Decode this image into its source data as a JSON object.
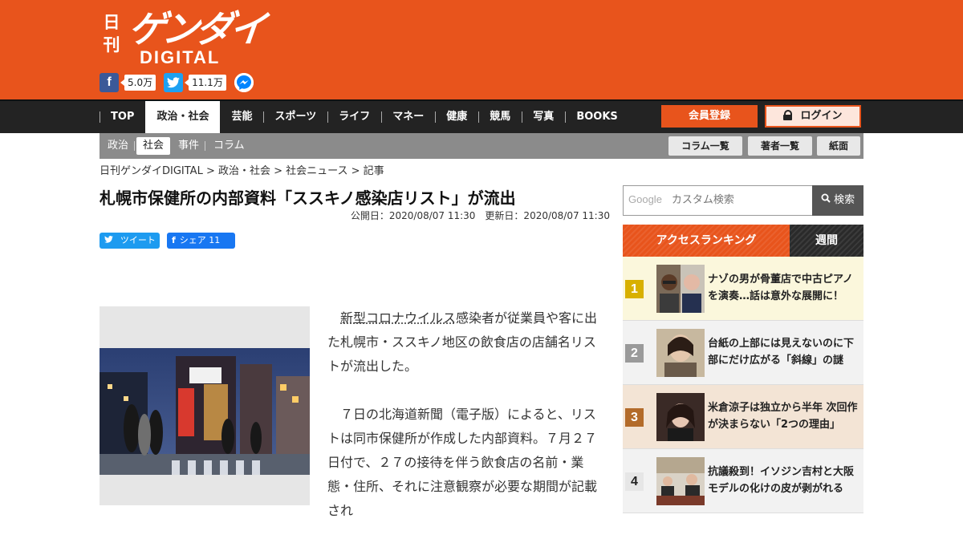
{
  "brand": {
    "logo_nikkan": "日刊",
    "logo_gendai": "ゲンダイ",
    "logo_digital": "DIGITAL"
  },
  "social": {
    "facebook_count": "5.0万",
    "twitter_count": "11.1万"
  },
  "nav": {
    "items": [
      "TOP",
      "政治・社会",
      "芸能",
      "スポーツ",
      "ライフ",
      "マネー",
      "健康",
      "競馬",
      "写真",
      "BOOKS"
    ],
    "member_label": "会員登録",
    "login_label": "ログイン"
  },
  "subnav": {
    "items": [
      "政治",
      "社会",
      "事件",
      "コラム"
    ],
    "buttons": [
      "コラム一覧",
      "著者一覧",
      "紙面"
    ]
  },
  "breadcrumb": "日刊ゲンダイDIGITAL > 政治・社会 > 社会ニュース > 記事",
  "article": {
    "title": "札幌市保健所の内部資料「ススキノ感染店リスト」が流出",
    "dates": "公開日：2020/08/07 11:30　更新日：2020/08/07 11:30",
    "tweet_label": "ツイート",
    "share_label": "シェア 11",
    "body_link": "新型コロナウイルス",
    "body_p1_rest": "感染者が従業員や客に出た札幌市・ススキノ地区の飲食店の店舗名リストが流出した。",
    "body_p2": "７日の北海道新聞（電子版）によると、リストは同市保健所が作成した内部資料。７月２７日付で、２７の接待を伴う飲食店の名前・業態・住所、それに注意観察が必要な期間が記載され"
  },
  "sidebar": {
    "search_google": "Google",
    "search_placeholder": "カスタム検索",
    "search_button": "検索",
    "tab_access": "アクセスランキング",
    "tab_weekly": "週間",
    "ranking": [
      {
        "num": "1",
        "text": "ナゾの男が骨董店で中古ピアノを演奏…話は意外な展開に！"
      },
      {
        "num": "2",
        "text": "台紙の上部には見えないのに下部にだけ広がる「斜線」の謎"
      },
      {
        "num": "3",
        "text": "米倉涼子は独立から半年 次回作が決まらない「2つの理由」"
      },
      {
        "num": "4",
        "text": "抗議殺到！イソジン吉村と大阪モデルの化けの皮が剥がれる"
      }
    ]
  },
  "colors": {
    "brand_orange": "#e8541c",
    "nav_dark": "#232323",
    "subnav_gray": "#8b8b8b"
  }
}
